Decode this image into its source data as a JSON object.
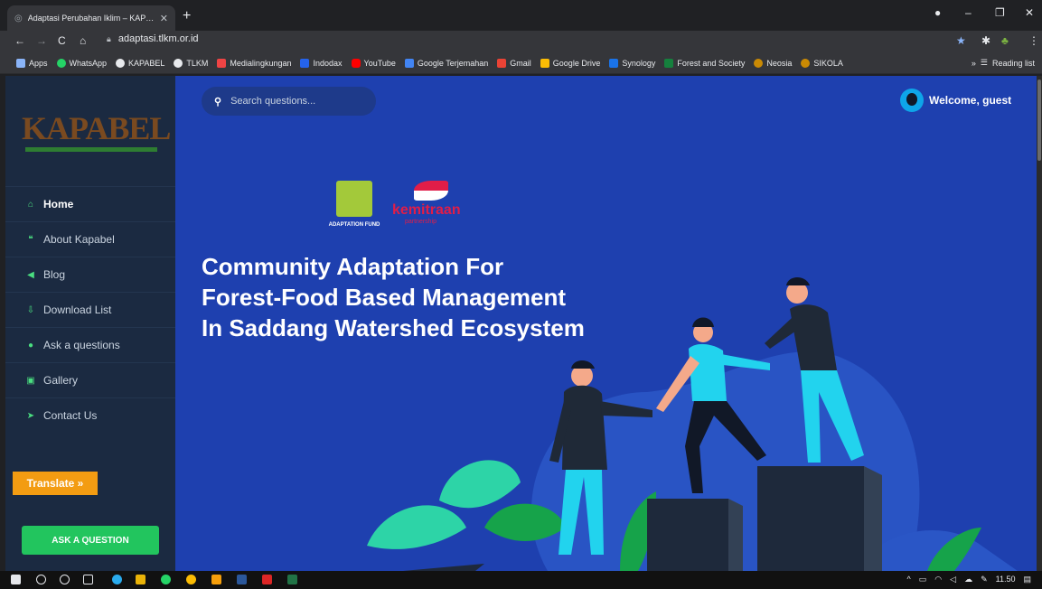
{
  "browser": {
    "tab_title": "Adaptasi Perubahan Iklim – KAP…",
    "url": "adaptasi.tlkm.or.id",
    "bookmarks": [
      "Apps",
      "WhatsApp",
      "KAPABEL",
      "TLKM",
      "Medialingkungan",
      "Indodax",
      "YouTube",
      "Google Terjemahan",
      "Gmail",
      "Google Drive",
      "Synology",
      "Forest and Society",
      "Neosia",
      "SIKOLA"
    ],
    "reading_list": "Reading list"
  },
  "sidebar": {
    "logo": "KAPABEL",
    "items": [
      {
        "label": "Home",
        "icon": "home-icon"
      },
      {
        "label": "About Kapabel",
        "icon": "quote-icon"
      },
      {
        "label": "Blog",
        "icon": "megaphone-icon"
      },
      {
        "label": "Download List",
        "icon": "download-icon"
      },
      {
        "label": "Ask a questions",
        "icon": "chat-icon"
      },
      {
        "label": "Gallery",
        "icon": "gallery-icon"
      },
      {
        "label": "Contact Us",
        "icon": "send-icon"
      }
    ],
    "ask_button": "ASK A QUESTION"
  },
  "header": {
    "search_placeholder": "Search questions...",
    "welcome": "Welcome, guest"
  },
  "partners": {
    "adaptation_fund": "ADAPTATION FUND",
    "kemitraan": "kemitraan",
    "kemitraan_sub": "partnership"
  },
  "hero": {
    "line1": "Community Adaptation For",
    "line2": "Forest-Food Based Management",
    "line3": "In Saddang Watershed Ecosystem"
  },
  "translate": "Translate »",
  "taskbar": {
    "time": "11.50"
  },
  "colors": {
    "accent": "#22c55e",
    "hero_bg": "#1e40af",
    "sidebar_bg": "#1b2a41"
  }
}
